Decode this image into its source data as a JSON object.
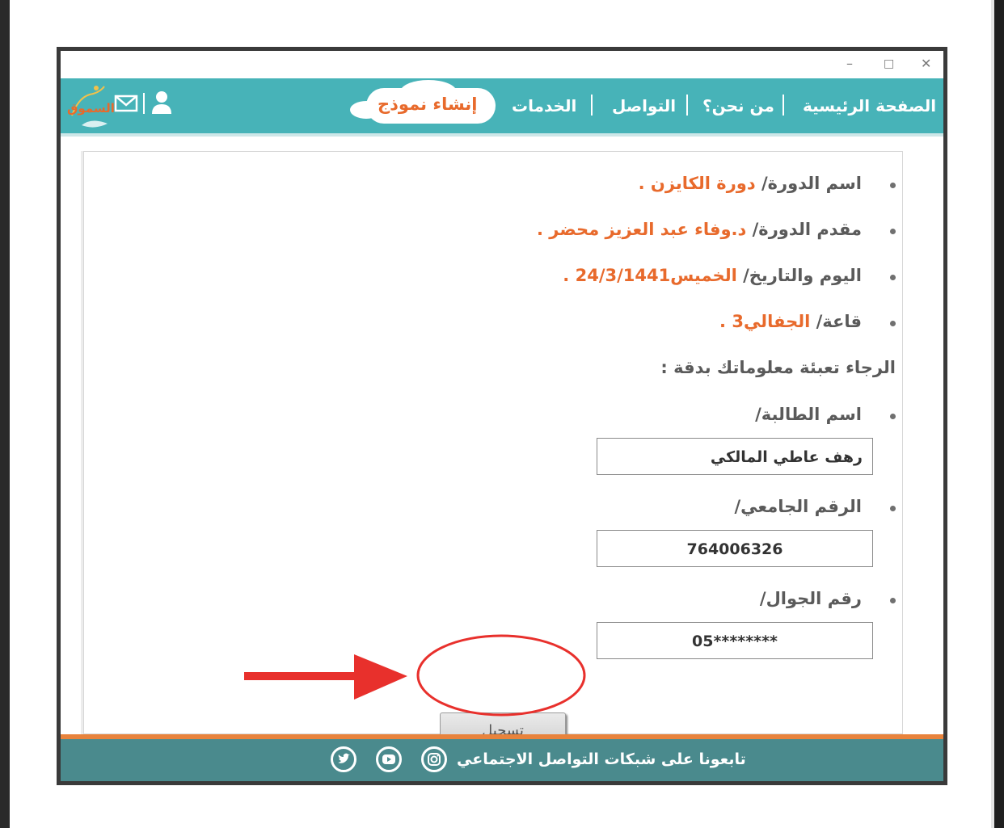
{
  "window": {
    "min_icon": "minimize-icon",
    "max_icon": "maximize-icon",
    "close_icon": "close-icon"
  },
  "header": {
    "logo_text": "السموق",
    "nav": [
      {
        "label": "الصفحة الرئيسية"
      },
      {
        "label": "من نحن؟"
      },
      {
        "label": "التواصل"
      },
      {
        "label": "الخدمات"
      },
      {
        "label": "إنشاء نموذج"
      }
    ],
    "icons": [
      "user-icon",
      "mail-icon"
    ]
  },
  "course": {
    "name_label": "اسم الدورة/",
    "name_value": "دورة الكايزن .",
    "presenter_label": "مقدم الدورة/",
    "presenter_value": "د.وفاء عبد العزيز محضر .",
    "date_label": "اليوم والتاريخ/",
    "date_value": "الخميس24/3/1441 .",
    "hall_label": "قاعة/",
    "hall_value": "الجفالي3 ."
  },
  "form": {
    "instruction": "الرجاء تعبئة معلوماتك بدقة :",
    "student_name_label": "اسم الطالبة/",
    "student_name_value": "رهف عاطي المالكي",
    "university_id_label": "الرقم الجامعي/",
    "university_id_value": "764006326",
    "mobile_label": "رقم الجوال/",
    "mobile_value": "05********",
    "submit_label": "تسجيل"
  },
  "footer": {
    "text": "تابعونا على شبكات التواصل الاجتماعي",
    "social": [
      "instagram-icon",
      "youtube-icon",
      "twitter-icon"
    ]
  },
  "colors": {
    "header_teal": "#47b3b8",
    "accent_orange": "#e86a2c",
    "footer_teal": "#4a8a8d",
    "annotation_red": "#e8302c"
  }
}
